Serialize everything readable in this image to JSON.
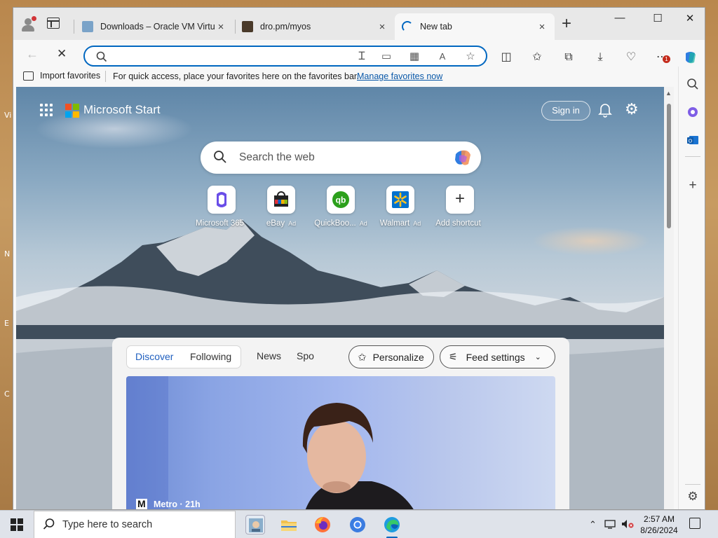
{
  "desktop": {
    "fragments": [
      "Vi",
      "N",
      "E",
      "C"
    ]
  },
  "tabs": [
    {
      "title": "Downloads – Oracle VM VirtualBox",
      "close": "×",
      "favicon_color": "#7aa3c8"
    },
    {
      "title": "dro.pm/myos",
      "close": "×",
      "favicon_color": "#4a3a2a"
    },
    {
      "title": "New tab",
      "close": "×",
      "loading": true
    }
  ],
  "new_tab_symbol": "+",
  "window_controls": {
    "minimize": "—",
    "maximize": "☐",
    "close": "✕"
  },
  "toolbar": {
    "back": "←",
    "stop": "✕",
    "address": "",
    "extensions_badge": "1"
  },
  "favorites_bar": {
    "import_label": "Import favorites",
    "message": "For quick access, place your favorites here on the favorites bar.",
    "manage_link": "Manage favorites now"
  },
  "start_page": {
    "brand": "Microsoft Start",
    "sign_in": "Sign in",
    "search_placeholder": "Search the web",
    "shortcuts": [
      {
        "label": "Microsoft 365",
        "ad": ""
      },
      {
        "label": "eBay",
        "ad": "Ad"
      },
      {
        "label": "QuickBoo...",
        "ad": "Ad"
      },
      {
        "label": "Walmart",
        "ad": "Ad"
      },
      {
        "label": "Add shortcut",
        "ad": ""
      }
    ],
    "feed": {
      "tabs": [
        "Discover",
        "Following"
      ],
      "extra_tabs": [
        "News",
        "Spo"
      ],
      "personalize": "Personalize",
      "feed_settings": "Feed settings",
      "card_source": "Metro · 21h"
    }
  },
  "taskbar": {
    "search_placeholder": "Type here to search",
    "time": "2:57 AM",
    "date": "8/26/2024"
  },
  "colors": {
    "accent": "#0067c0",
    "link": "#0a58a8",
    "discover": "#1f5fbf"
  }
}
